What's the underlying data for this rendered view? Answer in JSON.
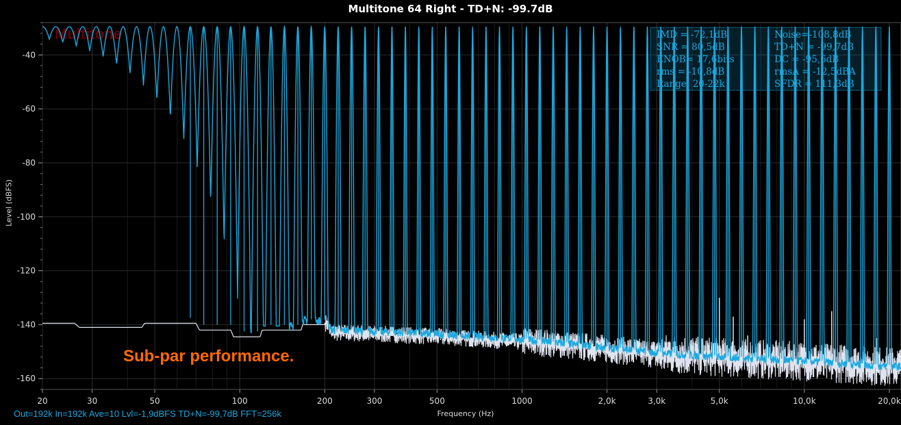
{
  "colors": {
    "spectrum": "#1ba9e0",
    "noise": "#dfe3ee",
    "grid": "#2a2a2a",
    "annotation": "#ff6a00",
    "watermark": "#6b0000"
  },
  "chart_data": {
    "type": "line",
    "title": "Multitone 64 Right - TD+N: -99.7dB",
    "xlabel": "Frequency (Hz)",
    "ylabel": "Level (dBFS)",
    "xscale": "log",
    "xlim": [
      20,
      22000
    ],
    "ylim": [
      -164,
      -28
    ],
    "grid": true,
    "x_ticks": [
      {
        "value": 20,
        "label": "20"
      },
      {
        "value": 30,
        "label": "30"
      },
      {
        "value": 50,
        "label": "50"
      },
      {
        "value": 100,
        "label": "100"
      },
      {
        "value": 200,
        "label": "200"
      },
      {
        "value": 300,
        "label": "300"
      },
      {
        "value": 500,
        "label": "500"
      },
      {
        "value": 1000,
        "label": "1000"
      },
      {
        "value": 2000,
        "label": "2,0k"
      },
      {
        "value": 3000,
        "label": "3,0k"
      },
      {
        "value": 5000,
        "label": "5,0k"
      },
      {
        "value": 10000,
        "label": "10,0k"
      },
      {
        "value": 20000,
        "label": "20,0k"
      }
    ],
    "y_ticks": [
      {
        "value": -40,
        "label": "-40"
      },
      {
        "value": -60,
        "label": "-60"
      },
      {
        "value": -80,
        "label": "-80"
      },
      {
        "value": -100,
        "label": "-100"
      },
      {
        "value": -120,
        "label": "-120"
      },
      {
        "value": -140,
        "label": "-140"
      },
      {
        "value": -160,
        "label": "-160"
      }
    ],
    "tones": {
      "count": 64,
      "f_start": 20,
      "f_end": 20000,
      "peak_level": -29.5
    },
    "noise_floor": [
      {
        "x": 20,
        "y": -139.5
      },
      {
        "x": 26,
        "y": -139.5
      },
      {
        "x": 27,
        "y": -141
      },
      {
        "x": 45,
        "y": -141
      },
      {
        "x": 46,
        "y": -139.5
      },
      {
        "x": 70,
        "y": -139.5
      },
      {
        "x": 72,
        "y": -142
      },
      {
        "x": 93,
        "y": -142
      },
      {
        "x": 95,
        "y": -144.5
      },
      {
        "x": 118,
        "y": -144.5
      },
      {
        "x": 120,
        "y": -142
      },
      {
        "x": 165,
        "y": -142
      },
      {
        "x": 167,
        "y": -140
      },
      {
        "x": 205,
        "y": -140
      },
      {
        "x": 210,
        "y": -143.5
      },
      {
        "x": 300,
        "y": -144
      },
      {
        "x": 500,
        "y": -145
      },
      {
        "x": 1000,
        "y": -147
      },
      {
        "x": 2000,
        "y": -150
      },
      {
        "x": 3000,
        "y": -152
      },
      {
        "x": 5000,
        "y": -153.5
      },
      {
        "x": 10000,
        "y": -155
      },
      {
        "x": 20000,
        "y": -157
      },
      {
        "x": 22000,
        "y": -157
      }
    ],
    "spurs": [
      {
        "x": 2000,
        "y": -150
      },
      {
        "x": 3000,
        "y": -147
      },
      {
        "x": 5000,
        "y": -130
      },
      {
        "x": 5600,
        "y": -137
      },
      {
        "x": 6300,
        "y": -144
      },
      {
        "x": 10000,
        "y": -138
      },
      {
        "x": 12500,
        "y": -135
      },
      {
        "x": 15000,
        "y": -149
      },
      {
        "x": 18000,
        "y": -145
      }
    ],
    "annotation": "Sub-par performance.",
    "watermark": "Multitone"
  },
  "stats_panel": {
    "rows": [
      {
        "left": "IMD = -72,1dB",
        "right": "Noise=-108,8dB"
      },
      {
        "left": "SNR =  80,5dB",
        "right": "TD+N = -99,7dB"
      },
      {
        "left": "ENOB=  17,6bits",
        "right": "DC   = -95,6dB"
      },
      {
        "left": "rms = -10,8dB",
        "right": "rmsA  = -12,5dBA"
      },
      {
        "left": "Range:  20-22k",
        "right": "SFDR = 111,3dB"
      }
    ]
  },
  "status_bar": "Out=192k  In=192k  Ave=10  Lvl=-1,9dBFS  TD+N=-99,7dB  FFT=256k"
}
